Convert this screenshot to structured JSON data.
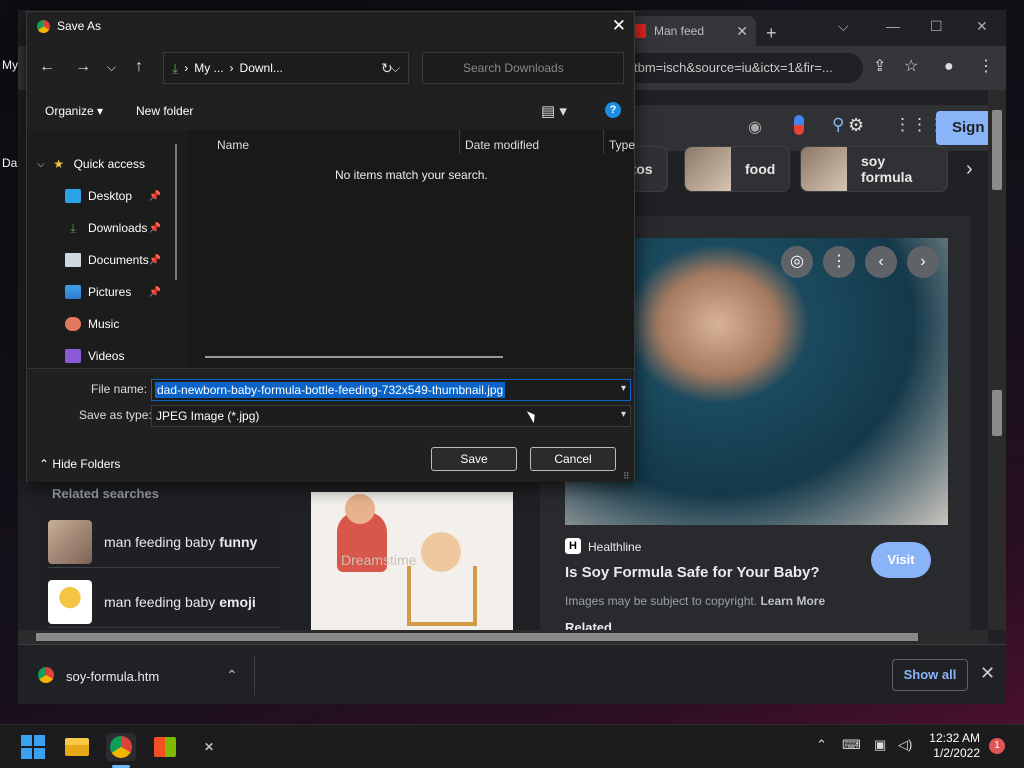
{
  "desktop": {
    "frag1": "My",
    "frag2": "Da"
  },
  "browser": {
    "tab_title": "Man feed",
    "tab_close": "✕",
    "new_tab": "+",
    "window_controls": {
      "minimize": "—",
      "maximize": "☐",
      "close": "✕",
      "tab_list": "⌵"
    },
    "url_text": "tbm=isch&source=iu&ictx=1&fir=...",
    "signin_label": "Sign i",
    "chips": [
      {
        "label": "otos"
      },
      {
        "label": "food"
      },
      {
        "label": "soy formula"
      }
    ],
    "related": {
      "title": "Related searches",
      "items": [
        {
          "prefix": "man feeding baby ",
          "bold": "funny"
        },
        {
          "prefix": "man feeding baby ",
          "bold": "emoji"
        }
      ]
    },
    "illustration_watermark": "Dreamstime",
    "preview": {
      "source": "Healthline",
      "title": "Is Soy Formula Safe for Your Baby?",
      "copyright": "Images may be subject to copyright.",
      "learn_more": "Learn More",
      "visit_label": "Visit",
      "next_heading_frag": "Related"
    },
    "download": {
      "filename": "soy-formula.htm",
      "show_all": "Show all",
      "close": "✕"
    }
  },
  "dialog": {
    "title": "Save As",
    "close": "✕",
    "breadcrumb": [
      "My ...",
      "Downl..."
    ],
    "search_placeholder": "Search Downloads",
    "organize_label": "Organize",
    "new_folder_label": "New folder",
    "help": "?",
    "nav_items": [
      {
        "label": "Quick access",
        "icon": "star-icon",
        "pinned": false
      },
      {
        "label": "Desktop",
        "icon": "desktop-icon",
        "pinned": true
      },
      {
        "label": "Downloads",
        "icon": "download-icon",
        "pinned": true
      },
      {
        "label": "Documents",
        "icon": "documents-icon",
        "pinned": true
      },
      {
        "label": "Pictures",
        "icon": "pictures-icon",
        "pinned": true
      },
      {
        "label": "Music",
        "icon": "music-icon",
        "pinned": false
      },
      {
        "label": "Videos",
        "icon": "videos-icon",
        "pinned": false
      }
    ],
    "columns": {
      "name": "Name",
      "date": "Date modified",
      "type": "Type"
    },
    "empty_message": "No items match your search.",
    "file_name_label": "File name:",
    "file_name_value": "dad-newborn-baby-formula-bottle-feeding-732x549-thumbnail.jpg",
    "save_type_label": "Save as type:",
    "save_type_value": "JPEG Image (*.jpg)",
    "hide_folders": "Hide Folders",
    "save_label": "Save",
    "cancel_label": "Cancel"
  },
  "taskbar": {
    "time": "12:32 AM",
    "date": "1/2/2022",
    "notification_count": "1"
  },
  "colors": {
    "accent": "#0a64c8",
    "visit": "#8ab4f8",
    "signin": "#8ab4f8"
  }
}
